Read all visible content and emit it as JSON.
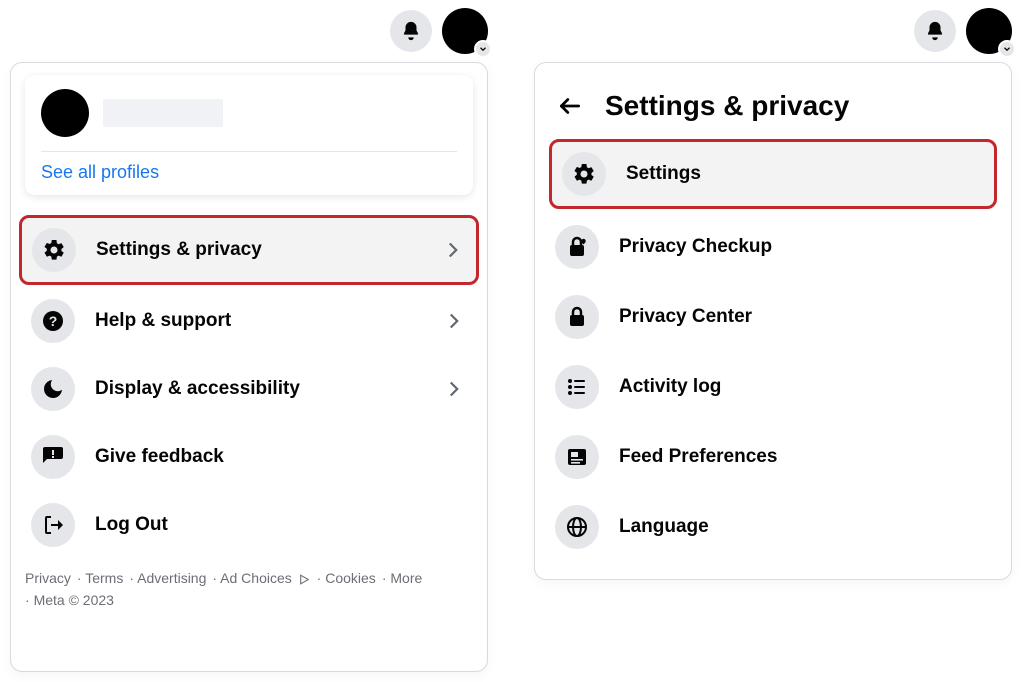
{
  "topbar": {
    "bell": "notifications"
  },
  "panel1": {
    "see_all_profiles": "See all profiles",
    "items": [
      {
        "label": "Settings & privacy",
        "chevron": true,
        "highlight": true,
        "icon": "gear"
      },
      {
        "label": "Help & support",
        "chevron": true,
        "highlight": false,
        "icon": "help"
      },
      {
        "label": "Display & accessibility",
        "chevron": true,
        "highlight": false,
        "icon": "moon"
      },
      {
        "label": "Give feedback",
        "chevron": false,
        "highlight": false,
        "icon": "feedback"
      },
      {
        "label": "Log Out",
        "chevron": false,
        "highlight": false,
        "icon": "logout"
      }
    ],
    "footer": {
      "privacy": "Privacy",
      "terms": "Terms",
      "advertising": "Advertising",
      "adchoices": "Ad Choices",
      "cookies": "Cookies",
      "more": "More",
      "meta": "Meta © 2023"
    }
  },
  "panel2": {
    "title": "Settings & privacy",
    "items": [
      {
        "label": "Settings",
        "highlight": true,
        "icon": "gear"
      },
      {
        "label": "Privacy Checkup",
        "highlight": false,
        "icon": "lockheart"
      },
      {
        "label": "Privacy Center",
        "highlight": false,
        "icon": "lock"
      },
      {
        "label": "Activity log",
        "highlight": false,
        "icon": "list"
      },
      {
        "label": "Feed Preferences",
        "highlight": false,
        "icon": "feed"
      },
      {
        "label": "Language",
        "highlight": false,
        "icon": "globe"
      }
    ]
  }
}
